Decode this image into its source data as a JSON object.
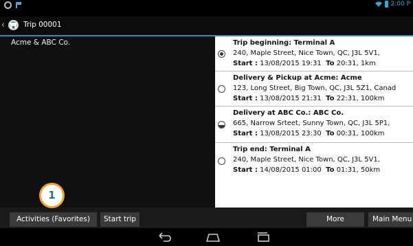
{
  "status_bar": {
    "time": "2:00 P",
    "icons": [
      "ring-icon",
      "flag-icon",
      "wifi-icon",
      "battery-icon"
    ],
    "accent": "#3aa6d6"
  },
  "header": {
    "title": "Trip 00001",
    "icons": [
      "back-chevron-icon",
      "app-logo-icon"
    ]
  },
  "left_pane": {
    "client": "Acme & ABC Co."
  },
  "stops": [
    {
      "title": "Trip beginning:  Terminal A",
      "address": "240, Maple Street, Nice Town, QC, J3L 5V1,",
      "start_label": "Start :",
      "start": "13/08/2015 19:31",
      "to_label": "To",
      "to": "20:31, 1km",
      "radio": "selected"
    },
    {
      "title": "Delivery & Pickup at Acme:  Acme",
      "address": "123, Long Street, Big Town, QC, J3L 5Z1, Canad",
      "start_label": "Start :",
      "start": "13/08/2015 21:31",
      "to_label": "To",
      "to": "22:31, 100km",
      "radio": "empty"
    },
    {
      "title": "Delivery at ABC Co.:  ABC Co.",
      "address": "665, Narrow Srteet, Sunny Town, QC, J3L 5P1,",
      "start_label": "Start :",
      "start": "13/08/2015 23:30",
      "to_label": "To",
      "to": "00:31, 100km",
      "radio": "half"
    },
    {
      "title": "Trip end:  Terminal A",
      "address": "240, Maple Street, Nice Town, QC, J3L 5V1,",
      "start_label": "Start :",
      "start": "14/08/2015 01:00",
      "to_label": "To",
      "to": "01:31, 50km",
      "radio": "empty"
    }
  ],
  "bottom_bar": {
    "activities_label": "Activities (Favorites)",
    "start_trip_label": "Start trip",
    "more_label": "More",
    "main_menu_label": "Main Menu"
  },
  "callout": {
    "number": "1",
    "color": "#f5a52a"
  },
  "nav_bar": {
    "icons": [
      "back-icon",
      "home-icon",
      "recents-icon"
    ]
  }
}
